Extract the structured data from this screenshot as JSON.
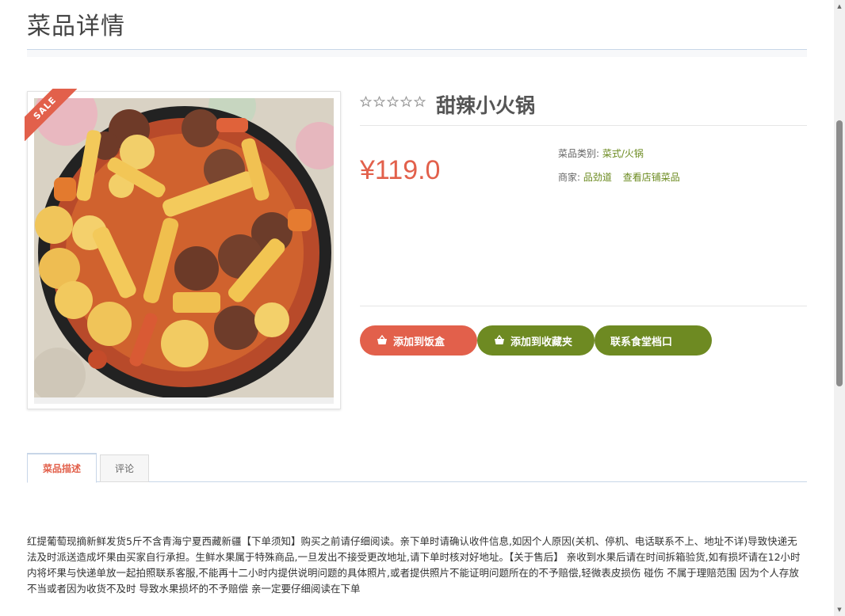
{
  "page": {
    "title": "菜品详情"
  },
  "product": {
    "sale_badge": "SALE",
    "name": "甜辣小火锅",
    "price": "¥119.0",
    "rating_stars": 0,
    "rating_max": 5,
    "category_label": "菜品类别:",
    "category_value": "菜式/火锅",
    "merchant_label": "商家:",
    "merchant_value": "品劲道",
    "merchant_link": "查看店铺菜品"
  },
  "actions": {
    "add_to_cart": "添加到饭盒",
    "add_to_favorites": "添加到收藏夹",
    "contact": "联系食堂档口"
  },
  "tabs": [
    {
      "label": "菜品描述",
      "active": true
    },
    {
      "label": "评论",
      "active": false
    }
  ],
  "description": "红提葡萄现摘新鲜发货5斤不含青海宁夏西藏新疆【下单须知】购买之前请仔细阅读。亲下单时请确认收件信息,如因个人原因(关机、停机、电话联系不上、地址不详)导致快递无法及时派送造成坏果由买家自行承担。生鲜水果属于特殊商品,一旦发出不接受更改地址,请下单时核对好地址。【关于售后】 亲收到水果后请在时间拆箱验货,如有损坏请在12小时内将坏果与快递单放一起拍照联系客服,不能再十二小时内提供说明问题的具体照片,或者提供照片不能证明问题所在的不予赔偿,轻微表皮损伤 碰伤 不属于理赔范围 因为个人存放不当或者因为收货不及时 导致水果损坏的不予赔偿 亲一定要仔细阅读在下单",
  "colors": {
    "accent": "#e2604b",
    "secondary": "#6e8a22",
    "link": "#6b8a1f",
    "rule": "#c8d6e8"
  },
  "icons": {
    "cart": "basket-icon",
    "favorite": "basket-icon",
    "star": "star-outline-icon"
  }
}
